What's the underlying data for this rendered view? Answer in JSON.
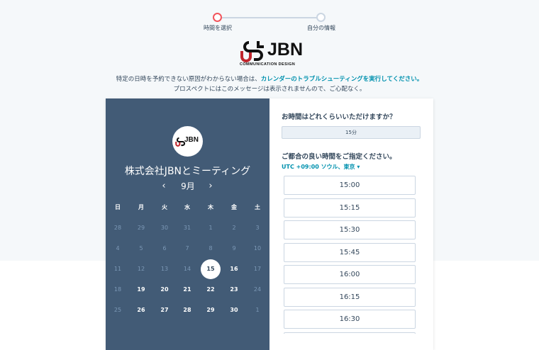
{
  "steps": [
    {
      "label": "時間を選択",
      "active": true
    },
    {
      "label": "自分の情報",
      "active": false
    }
  ],
  "logo": {
    "text": "JBN",
    "sub": "COMMUNICATION DESIGN"
  },
  "notice": {
    "line1_prefix": "特定の日時を予約できない原因がわからない場合は、",
    "line1_link": "カレンダーのトラブルシューティングを実行してください。",
    "line2": "プロスペクトにはこのメッセージは表示されませんので、ご心配なく。"
  },
  "meeting": {
    "title": "株式会社JBNとミーティング",
    "month": "9月",
    "prev_icon": "‹",
    "next_icon": "›"
  },
  "calendar": {
    "weekdays": [
      "日",
      "月",
      "火",
      "水",
      "木",
      "金",
      "土"
    ],
    "weeks": [
      [
        {
          "d": "28",
          "s": "muted"
        },
        {
          "d": "29",
          "s": "muted"
        },
        {
          "d": "30",
          "s": "muted"
        },
        {
          "d": "31",
          "s": "muted"
        },
        {
          "d": "1",
          "s": "muted"
        },
        {
          "d": "2",
          "s": "muted"
        },
        {
          "d": "3",
          "s": "muted"
        }
      ],
      [
        {
          "d": "4",
          "s": "muted"
        },
        {
          "d": "5",
          "s": "muted"
        },
        {
          "d": "6",
          "s": "muted"
        },
        {
          "d": "7",
          "s": "muted"
        },
        {
          "d": "8",
          "s": "muted"
        },
        {
          "d": "9",
          "s": "muted"
        },
        {
          "d": "10",
          "s": "muted"
        }
      ],
      [
        {
          "d": "11",
          "s": "muted"
        },
        {
          "d": "12",
          "s": "muted"
        },
        {
          "d": "13",
          "s": "muted"
        },
        {
          "d": "14",
          "s": "muted"
        },
        {
          "d": "15",
          "s": "selected"
        },
        {
          "d": "16",
          "s": "avail"
        },
        {
          "d": "17",
          "s": "muted"
        }
      ],
      [
        {
          "d": "18",
          "s": "muted"
        },
        {
          "d": "19",
          "s": "avail"
        },
        {
          "d": "20",
          "s": "avail"
        },
        {
          "d": "21",
          "s": "avail"
        },
        {
          "d": "22",
          "s": "avail"
        },
        {
          "d": "23",
          "s": "avail"
        },
        {
          "d": "24",
          "s": "muted"
        }
      ],
      [
        {
          "d": "25",
          "s": "muted"
        },
        {
          "d": "26",
          "s": "avail"
        },
        {
          "d": "27",
          "s": "avail"
        },
        {
          "d": "28",
          "s": "avail"
        },
        {
          "d": "29",
          "s": "avail"
        },
        {
          "d": "30",
          "s": "avail"
        },
        {
          "d": "1",
          "s": "muted"
        }
      ]
    ]
  },
  "right": {
    "duration_question": "お時間はどれくらいいただけますか？",
    "duration_value": "15分",
    "time_question": "ご都合の良い時間をご指定ください。",
    "timezone": "UTC +09:00 ソウル、東京 ▾",
    "slots": [
      "15:00",
      "15:15",
      "15:30",
      "15:45",
      "16:00",
      "16:15",
      "16:30",
      ""
    ]
  },
  "colors": {
    "accent": "#f2545b",
    "panel": "#425b76",
    "link": "#0091ae",
    "logo_red": "#c0262d"
  }
}
